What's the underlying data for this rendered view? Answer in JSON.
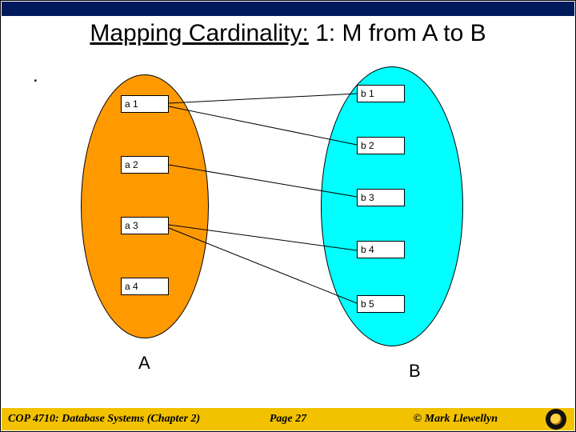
{
  "title_main": "Mapping Cardinality:",
  "title_sub": " 1: M from A to B",
  "setA": {
    "label": "A",
    "nodes": [
      "a 1",
      "a 2",
      "a 3",
      "a 4"
    ]
  },
  "setB": {
    "label": "B",
    "nodes": [
      "b 1",
      "b 2",
      "b 3",
      "b 4",
      "b 5"
    ]
  },
  "mappings": [
    {
      "from": "a1",
      "to": "b1"
    },
    {
      "from": "a1",
      "to": "b2"
    },
    {
      "from": "a2",
      "to": "b3"
    },
    {
      "from": "a3",
      "to": "b4"
    },
    {
      "from": "a3",
      "to": "b5"
    }
  ],
  "footer": {
    "course": "COP 4710: Database Systems (Chapter 2)",
    "page": "Page 27",
    "author": "© Mark Llewellyn"
  },
  "dot": "."
}
